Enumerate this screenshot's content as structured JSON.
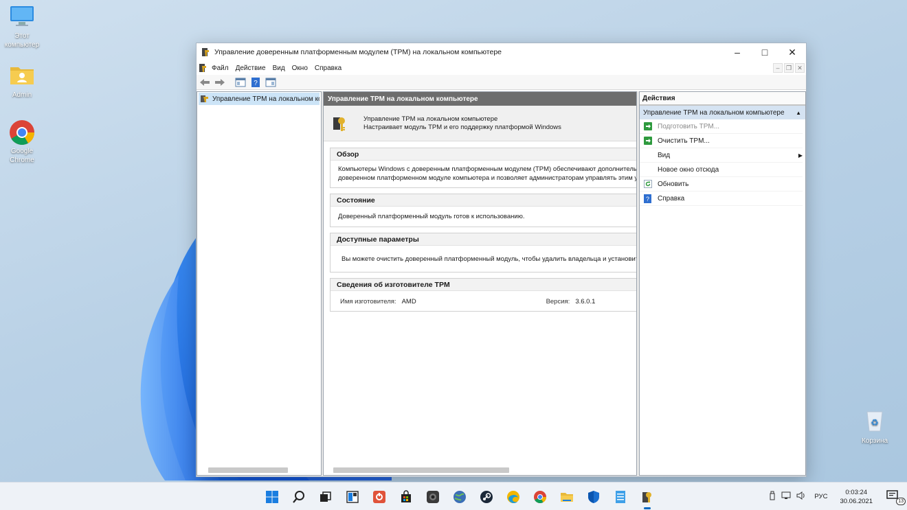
{
  "desktop": {
    "icons": [
      {
        "label": "Этот компьютер",
        "icon": "monitor-icon"
      },
      {
        "label": "Admin",
        "icon": "user-folder-icon"
      },
      {
        "label": "Google Chrome",
        "icon": "chrome-icon"
      },
      {
        "label": "Корзина",
        "icon": "recycle-bin-icon"
      }
    ]
  },
  "window": {
    "title": "Управление доверенным платформенным модулем (TPM) на локальном компьютере",
    "menu": [
      "Файл",
      "Действие",
      "Вид",
      "Окно",
      "Справка"
    ],
    "tree": {
      "item": "Управление TPM на локальном компьютере"
    },
    "center": {
      "header": "Управление TPM на локальном компьютере",
      "intro_title": "Управление TPM на локальном компьютере",
      "intro_desc": "Настраивает модуль TPM и его поддержку платформой Windows",
      "overview": {
        "title": "Обзор",
        "line1": "Компьютеры Windows с доверенным платформенным модулем (TPM) обеспечивают дополнительн",
        "line2": "доверенном платформенном модуле компьютера и позволяет администраторам управлять этим у"
      },
      "status": {
        "title": "Состояние",
        "text": "Доверенный платформенный модуль готов к использованию."
      },
      "options": {
        "title": "Доступные параметры",
        "text": "Вы можете очистить доверенный платформенный модуль, чтобы удалить владельца и установить"
      },
      "manufacturer": {
        "title": "Сведения об изготовителе TPM",
        "name_label": "Имя изготовителя:",
        "name_value": "AMD",
        "version_label": "Версия:",
        "version_value": "3.6.0.1"
      }
    },
    "actions": {
      "header": "Действия",
      "subheader": "Управление TPM на локальном компьютере",
      "items": [
        {
          "label": "Подготовить TPM...",
          "icon": "green-arrow-icon",
          "disabled": true
        },
        {
          "label": "Очистить TPM...",
          "icon": "green-arrow-icon",
          "disabled": false
        },
        {
          "label": "Вид",
          "icon": "",
          "submenu": true
        },
        {
          "label": "Новое окно отсюда",
          "icon": ""
        },
        {
          "label": "Обновить",
          "icon": "refresh-icon"
        },
        {
          "label": "Справка",
          "icon": "help-icon"
        }
      ]
    }
  },
  "taskbar": {
    "apps": [
      "start-icon",
      "search-icon",
      "task-view-icon",
      "widgets-icon",
      "office-icon",
      "store-icon",
      "camera-icon",
      "globe-icon",
      "steam-icon",
      "edge-icon",
      "chrome-icon",
      "explorer-icon",
      "defender-icon",
      "notepad-icon",
      "tpm-icon"
    ],
    "language": "РУС",
    "time": "0:03:24",
    "date": "30.06.2021",
    "notifications": "13"
  },
  "colors": {
    "accent": "#0067c0",
    "selection": "#cce4f7",
    "header_gray": "#6d6d6d"
  }
}
